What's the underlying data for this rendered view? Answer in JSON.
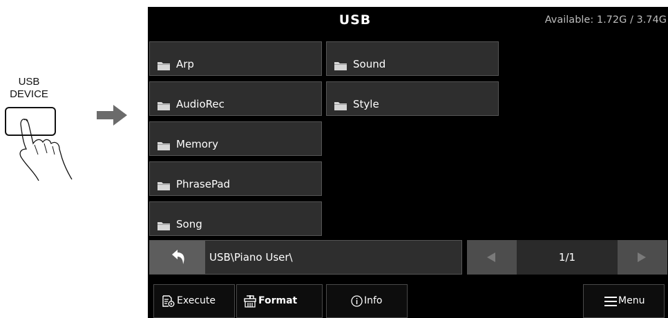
{
  "illustration": {
    "usb_button_line1": "USB",
    "usb_button_line2": "DEVICE",
    "hand_icon": "hand-pressing-icon",
    "arrow_icon": "arrow-right-icon"
  },
  "header": {
    "title": "USB",
    "available": "Available: 1.72G / 3.74G"
  },
  "folders": [
    {
      "name": "Arp",
      "icon": "folder-icon"
    },
    {
      "name": "Sound",
      "icon": "folder-icon"
    },
    {
      "name": "AudioRec",
      "icon": "folder-icon"
    },
    {
      "name": "Style",
      "icon": "folder-icon"
    },
    {
      "name": "Memory",
      "icon": "folder-icon"
    },
    {
      "name": "PhrasePad",
      "icon": "folder-icon"
    },
    {
      "name": "Song",
      "icon": "folder-icon"
    }
  ],
  "path": {
    "current": "USB\\Piano User\\",
    "back_icon": "back-arrow-icon"
  },
  "pager": {
    "page": "1/1",
    "prev_icon": "triangle-left-icon",
    "next_icon": "triangle-right-icon"
  },
  "toolbar": {
    "execute": "Execute",
    "format": "Format",
    "info": "Info",
    "menu": "Menu"
  },
  "colors": {
    "screen_bg": "#000000",
    "tile_bg": "#2e2e2e",
    "button_bg": "#5d5d5d"
  }
}
